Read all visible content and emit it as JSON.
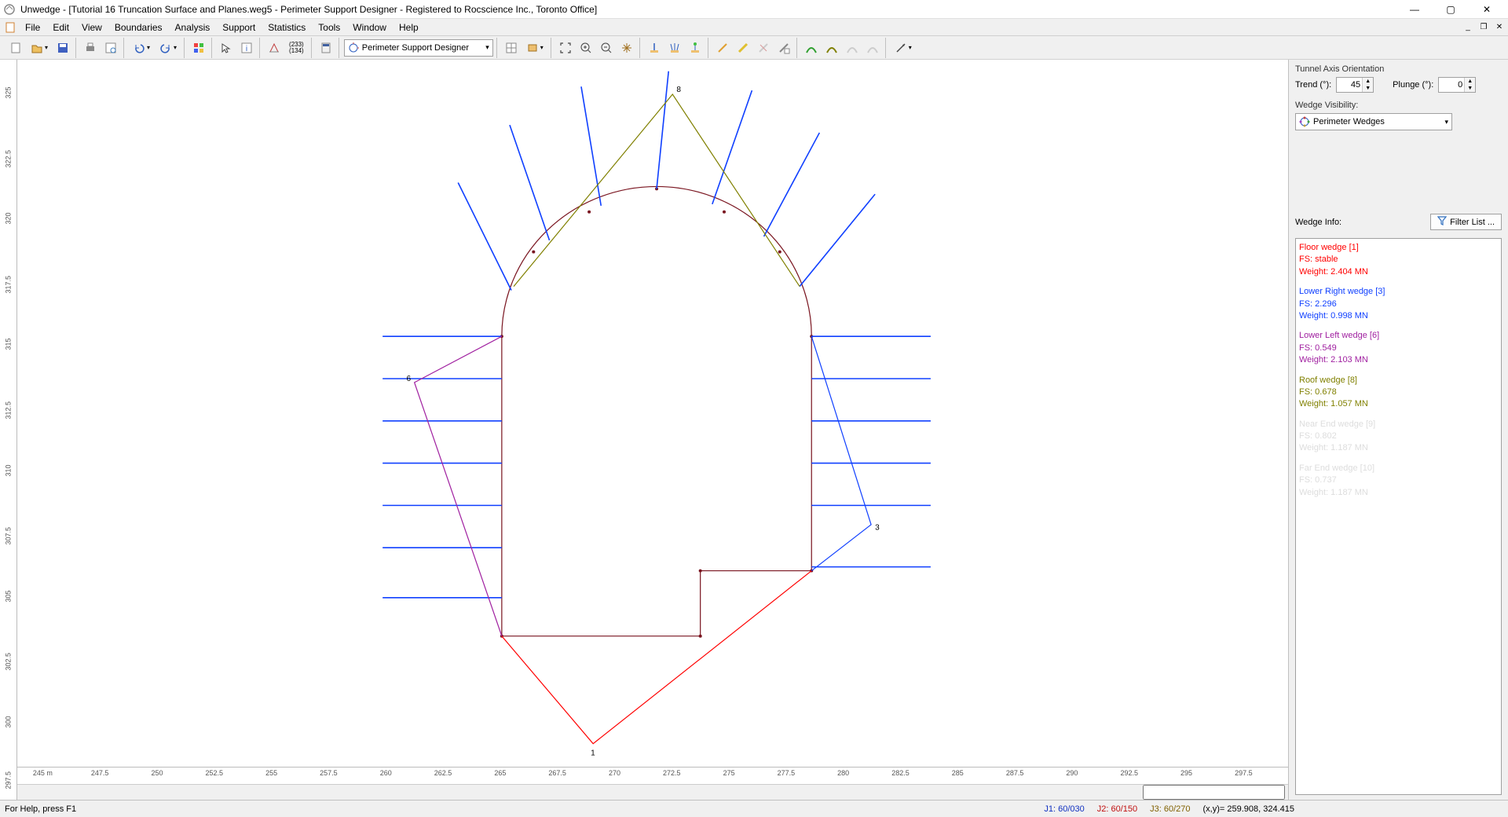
{
  "app": {
    "title": "Unwedge - [Tutorial 16 Truncation Surface and Planes.weg5 - Perimeter Support Designer - Registered to Rocscience Inc., Toronto Office]"
  },
  "menu": {
    "items": [
      "File",
      "Edit",
      "View",
      "Boundaries",
      "Analysis",
      "Support",
      "Statistics",
      "Tools",
      "Window",
      "Help"
    ]
  },
  "toolbar": {
    "view_combo": "Perimeter Support Designer",
    "ruler_coords": "(233)\n(134)"
  },
  "rulers": {
    "y_unit": "245 m",
    "y": [
      "297.5",
      "300",
      "302.5",
      "305",
      "307.5",
      "310",
      "312.5",
      "315",
      "317.5",
      "320",
      "322.5",
      "325"
    ],
    "x": [
      "245 m",
      "247.5",
      "250",
      "252.5",
      "255",
      "257.5",
      "260",
      "262.5",
      "265",
      "267.5",
      "270",
      "272.5",
      "275",
      "277.5",
      "280",
      "282.5",
      "285",
      "287.5",
      "290",
      "292.5",
      "295",
      "297.5"
    ]
  },
  "side": {
    "tunnel_axis_title": "Tunnel Axis Orientation",
    "trend_label": "Trend (°):",
    "trend_value": "45",
    "plunge_label": "Plunge (°):",
    "plunge_value": "0",
    "visibility_title": "Wedge Visibility:",
    "visibility_value": "Perimeter Wedges",
    "info_title": "Wedge Info:",
    "filter_btn": "Filter List ...",
    "wedges": [
      {
        "color": "#ff0000",
        "title": "Floor wedge [1]",
        "fs": "FS: stable",
        "weight": "Weight: 2.404 MN"
      },
      {
        "color": "#1040ff",
        "title": "Lower Right wedge [3]",
        "fs": "FS: 2.296",
        "weight": "Weight: 0.998 MN"
      },
      {
        "color": "#a020a0",
        "title": "Lower Left wedge [6]",
        "fs": "FS: 0.549",
        "weight": "Weight: 2.103 MN"
      },
      {
        "color": "#808000",
        "title": "Roof wedge [8]",
        "fs": "FS: 0.678",
        "weight": "Weight: 1.057 MN"
      },
      {
        "color": "#dddddd",
        "title": "Near End wedge [9]",
        "fs": "FS: 0.802",
        "weight": "Weight: 1.187 MN",
        "disabled": true
      },
      {
        "color": "#dddddd",
        "title": "Far End wedge [10]",
        "fs": "FS: 0.737",
        "weight": "Weight: 1.187 MN",
        "disabled": true
      }
    ]
  },
  "status": {
    "help": "For Help, press F1",
    "j1": "J1: 60/030",
    "j2": "J2: 60/150",
    "j3": "J3: 60/270",
    "xy": "(x,y)= 259.908, 324.415"
  },
  "labels": {
    "l1": "1",
    "l3": "3",
    "l6": "6",
    "l8": "8"
  }
}
